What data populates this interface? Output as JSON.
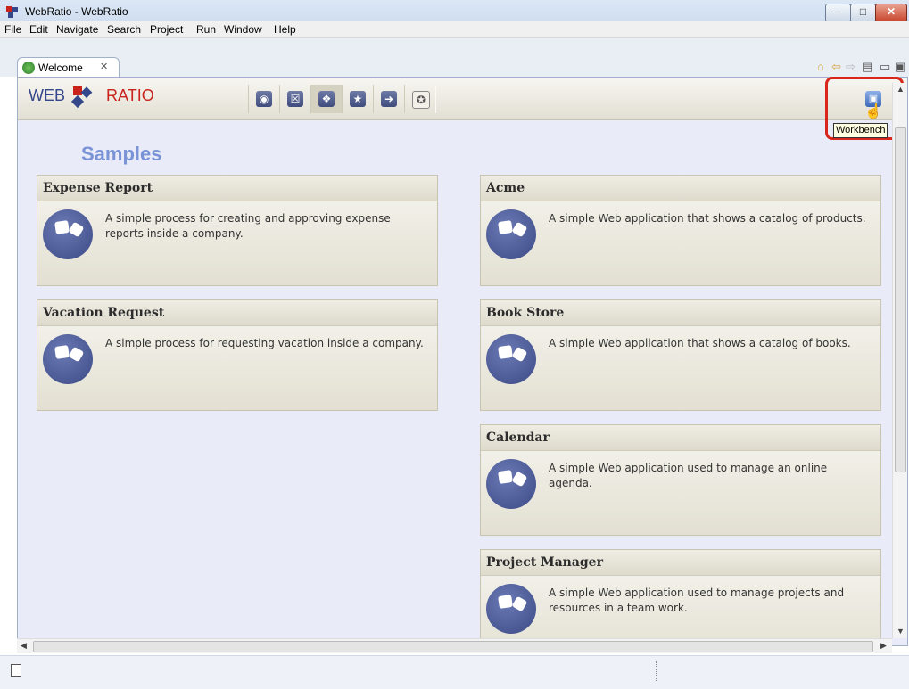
{
  "window": {
    "title": "WebRatio - WebRatio",
    "minimize_label": "─",
    "maximize_label": "□",
    "close_label": "✕"
  },
  "menu": {
    "items": [
      "File",
      "Edit",
      "Navigate",
      "Search",
      "Project",
      "Run",
      "Window",
      "Help"
    ]
  },
  "editor_tab": {
    "label": "Welcome",
    "close_label": "✕"
  },
  "logo": {
    "web": "WEB",
    "ratio": "RATIO"
  },
  "toolbar": {
    "buttons": [
      "overview",
      "tutorials",
      "samples",
      "whats-new",
      "first-steps",
      "web-resources"
    ],
    "active": "samples"
  },
  "workbench": {
    "tooltip": "Workbench"
  },
  "page": {
    "title": "Samples"
  },
  "samples": [
    {
      "title": "Expense Report",
      "description": "A simple process for creating and approving expense reports inside a company."
    },
    {
      "title": "Acme",
      "description": "A simple Web application that shows a catalog of products."
    },
    {
      "title": "Vacation Request",
      "description": "A simple process for requesting vacation inside a company."
    },
    {
      "title": "Book Store",
      "description": "A simple Web application that shows a catalog of books."
    },
    {
      "title": "Calendar",
      "description": "A simple Web application used to manage an online agenda."
    },
    {
      "title": "Project Manager",
      "description": "A simple Web application used to manage projects and resources in a team work."
    }
  ],
  "colors": {
    "accent": "#7a93d6",
    "highlight": "#d9261c"
  }
}
